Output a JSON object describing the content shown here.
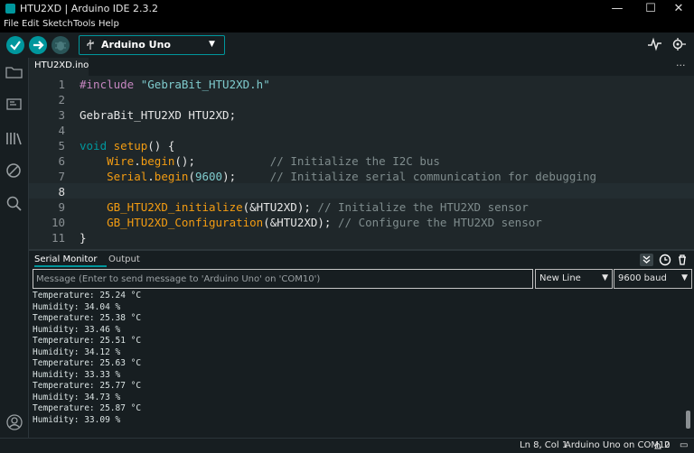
{
  "window": {
    "title": "HTU2XD | Arduino IDE 2.3.2",
    "controls": {
      "minimize": "—",
      "maximize": "☐",
      "close": "✕"
    }
  },
  "menu": [
    "File",
    "Edit",
    "Sketch",
    "Tools",
    "Help"
  ],
  "toolbar": {
    "board": "Arduino Uno",
    "icons": [
      "verify-icon",
      "upload-icon",
      "debug-icon",
      "usb-icon",
      "serial-plotter-icon",
      "serial-monitor-icon"
    ]
  },
  "tabs": {
    "file": "HTU2XD.ino",
    "more": "···"
  },
  "editor": {
    "current_line": 8,
    "lines": [
      {
        "n": "1"
      },
      {
        "n": "2"
      },
      {
        "n": "3"
      },
      {
        "n": "4"
      },
      {
        "n": "5"
      },
      {
        "n": "6"
      },
      {
        "n": "7"
      },
      {
        "n": "8"
      },
      {
        "n": "9"
      },
      {
        "n": "10"
      },
      {
        "n": "11"
      }
    ],
    "tokens": {
      "l1_pp": "#include",
      "l1_str": "\"GebraBit_HTU2XD.h\"",
      "l3": "GebraBit_HTU2XD HTU2XD;",
      "l5_kw": "void",
      "l5_fn": "setup",
      "l5_rest": "() {",
      "l6_obj": "Wire",
      "l6_fn": "begin",
      "l6_rest": "();",
      "l6_cm": "// Initialize the I2C bus",
      "l7_obj": "Serial",
      "l7_fn": "begin",
      "l7_num": "9600",
      "l7_rest": ");",
      "l7_cm": "// Initialize serial communication for debugging",
      "l9_fn": "GB_HTU2XD_initialize",
      "l9_rest": "(&HTU2XD);",
      "l9_cm": "// Initialize the HTU2XD sensor",
      "l10_fn": "GB_HTU2XD_Configuration",
      "l10_rest": "(&HTU2XD);",
      "l10_cm": "// Configure the HTU2XD sensor",
      "l11": "}"
    }
  },
  "serial": {
    "tab_serial": "Serial Monitor",
    "tab_output": "Output",
    "placeholder": "Message (Enter to send message to 'Arduino Uno' on 'COM10')",
    "line_ending": "New Line",
    "baud": "9600 baud",
    "output": [
      "Temperature: 25.24 °C",
      "Humidity: 34.04 %",
      "Temperature: 25.38 °C",
      "Humidity: 33.46 %",
      "Temperature: 25.51 °C",
      "Humidity: 34.12 %",
      "Temperature: 25.63 °C",
      "Humidity: 33.33 %",
      "Temperature: 25.77 °C",
      "Humidity: 34.73 %",
      "Temperature: 25.87 °C",
      "Humidity: 33.09 %"
    ]
  },
  "status": {
    "cursor": "Ln 8, Col 1",
    "board_port": "Arduino Uno on COM10",
    "notifications": "2"
  },
  "colors": {
    "accent": "#00979d",
    "background": "#171e21",
    "editor_bg": "#1f272a"
  }
}
